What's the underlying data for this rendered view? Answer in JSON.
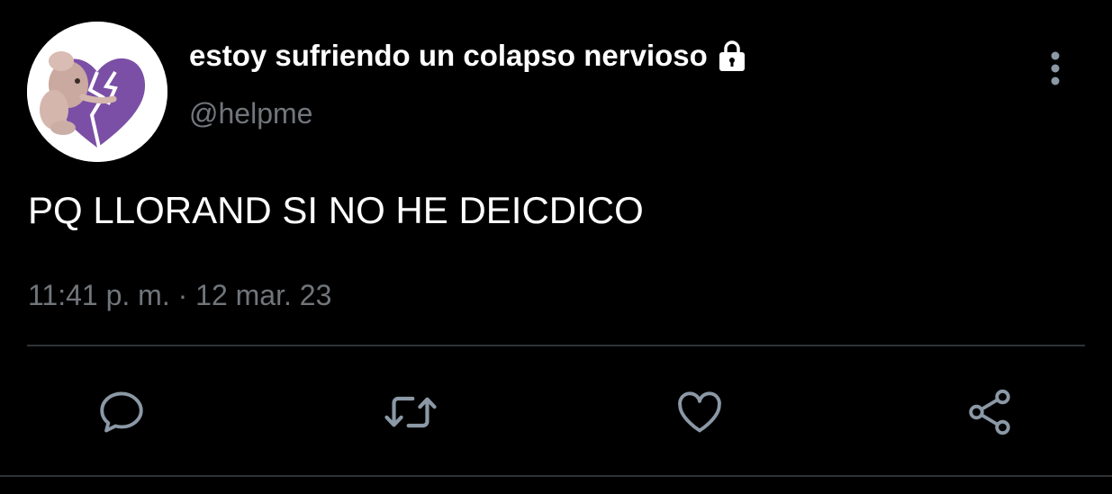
{
  "tweet": {
    "display_name": "estoy sufriendo un colapso nervioso",
    "handle": "@helpme",
    "text": "PQ LLORAND SI NO HE DEICDICO",
    "timestamp": "11:41 p. m. · 12 mar. 23",
    "protected_icon": "lock-icon"
  },
  "actions": [
    {
      "name": "reply",
      "icon": "reply-icon"
    },
    {
      "name": "retweet",
      "icon": "retweet-icon"
    },
    {
      "name": "like",
      "icon": "heart-icon"
    },
    {
      "name": "share",
      "icon": "share-icon"
    }
  ],
  "colors": {
    "background": "#000000",
    "primary_text": "#ffffff",
    "secondary_text": "#71767b",
    "divider": "#2f3336",
    "icon": "#8b98a5",
    "avatar_heart": "#7b4fa6"
  }
}
